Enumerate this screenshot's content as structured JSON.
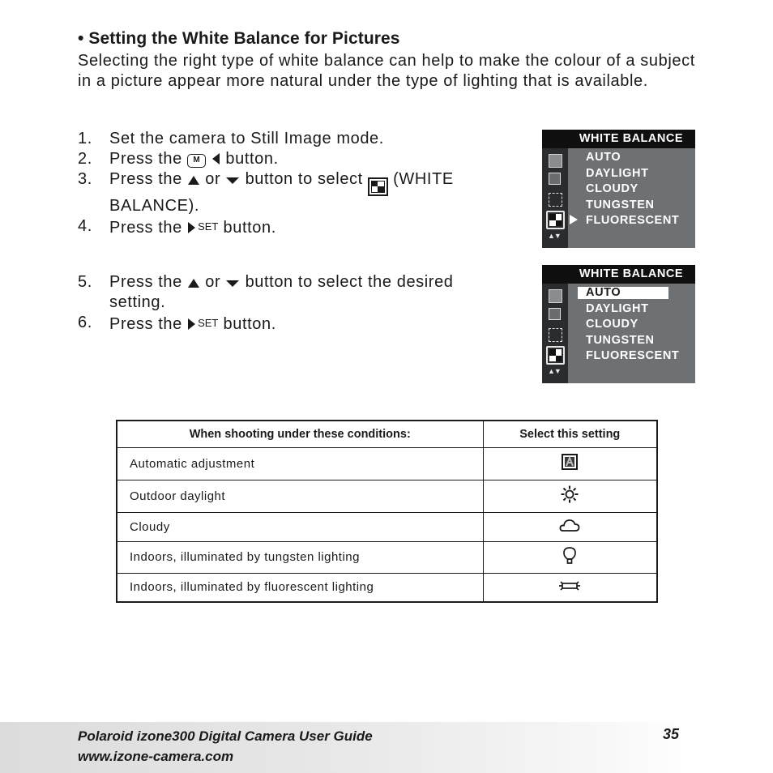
{
  "heading": "• Setting the White Balance for Pictures",
  "intro": "Selecting the right type of white balance can help to make the colour of a subject in a picture appear more natural under the type of lighting that is available.",
  "steps_group1": [
    {
      "num": "1.",
      "parts": [
        "Set the camera to Still Image mode."
      ]
    },
    {
      "num": "2.",
      "before": "Press the",
      "icons": [
        "menu-M-button-icon",
        "left-arrow-icon"
      ],
      "after": "button."
    },
    {
      "num": "3.",
      "before": "Press the",
      "mid": "or",
      "after": "button to select",
      "tail": "(WHITE BALANCE)."
    },
    {
      "num": "4.",
      "before": "Press the",
      "set_label": "SET",
      "after": "button."
    }
  ],
  "steps_group2": [
    {
      "num": "5.",
      "before": "Press the",
      "mid": "or",
      "after": "button to select the desired setting."
    },
    {
      "num": "6.",
      "before": "Press the",
      "set_label": "SET",
      "after": "button."
    }
  ],
  "m_label": "M",
  "lcd_screens": [
    {
      "title": "WHITE BALANCE",
      "items": [
        "AUTO",
        "DAYLIGHT",
        "CLOUDY",
        "TUNGSTEN",
        "FLUORESCENT"
      ],
      "pointer_item": "FLUORESCENT",
      "highlighted_item": null,
      "nav_hint": "▲▼"
    },
    {
      "title": "WHITE BALANCE",
      "items": [
        "AUTO",
        "DAYLIGHT",
        "CLOUDY",
        "TUNGSTEN",
        "FLUORESCENT"
      ],
      "pointer_item": null,
      "highlighted_item": "AUTO",
      "nav_hint": "▲▼"
    }
  ],
  "table": {
    "headers": [
      "When shooting under these conditions:",
      "Select this setting"
    ],
    "rows": [
      {
        "condition": "Automatic adjustment",
        "icon": "auto-wb-icon"
      },
      {
        "condition": "Outdoor daylight",
        "icon": "sun-icon"
      },
      {
        "condition": "Cloudy",
        "icon": "cloud-icon"
      },
      {
        "condition": "Indoors, illuminated by tungsten lighting",
        "icon": "bulb-icon"
      },
      {
        "condition": "Indoors, illuminated by fluorescent lighting",
        "icon": "fluorescent-tube-icon"
      }
    ]
  },
  "footer": {
    "title": "Polaroid izone300 Digital Camera User Guide",
    "url": "www.izone-camera.com",
    "page": "35"
  }
}
